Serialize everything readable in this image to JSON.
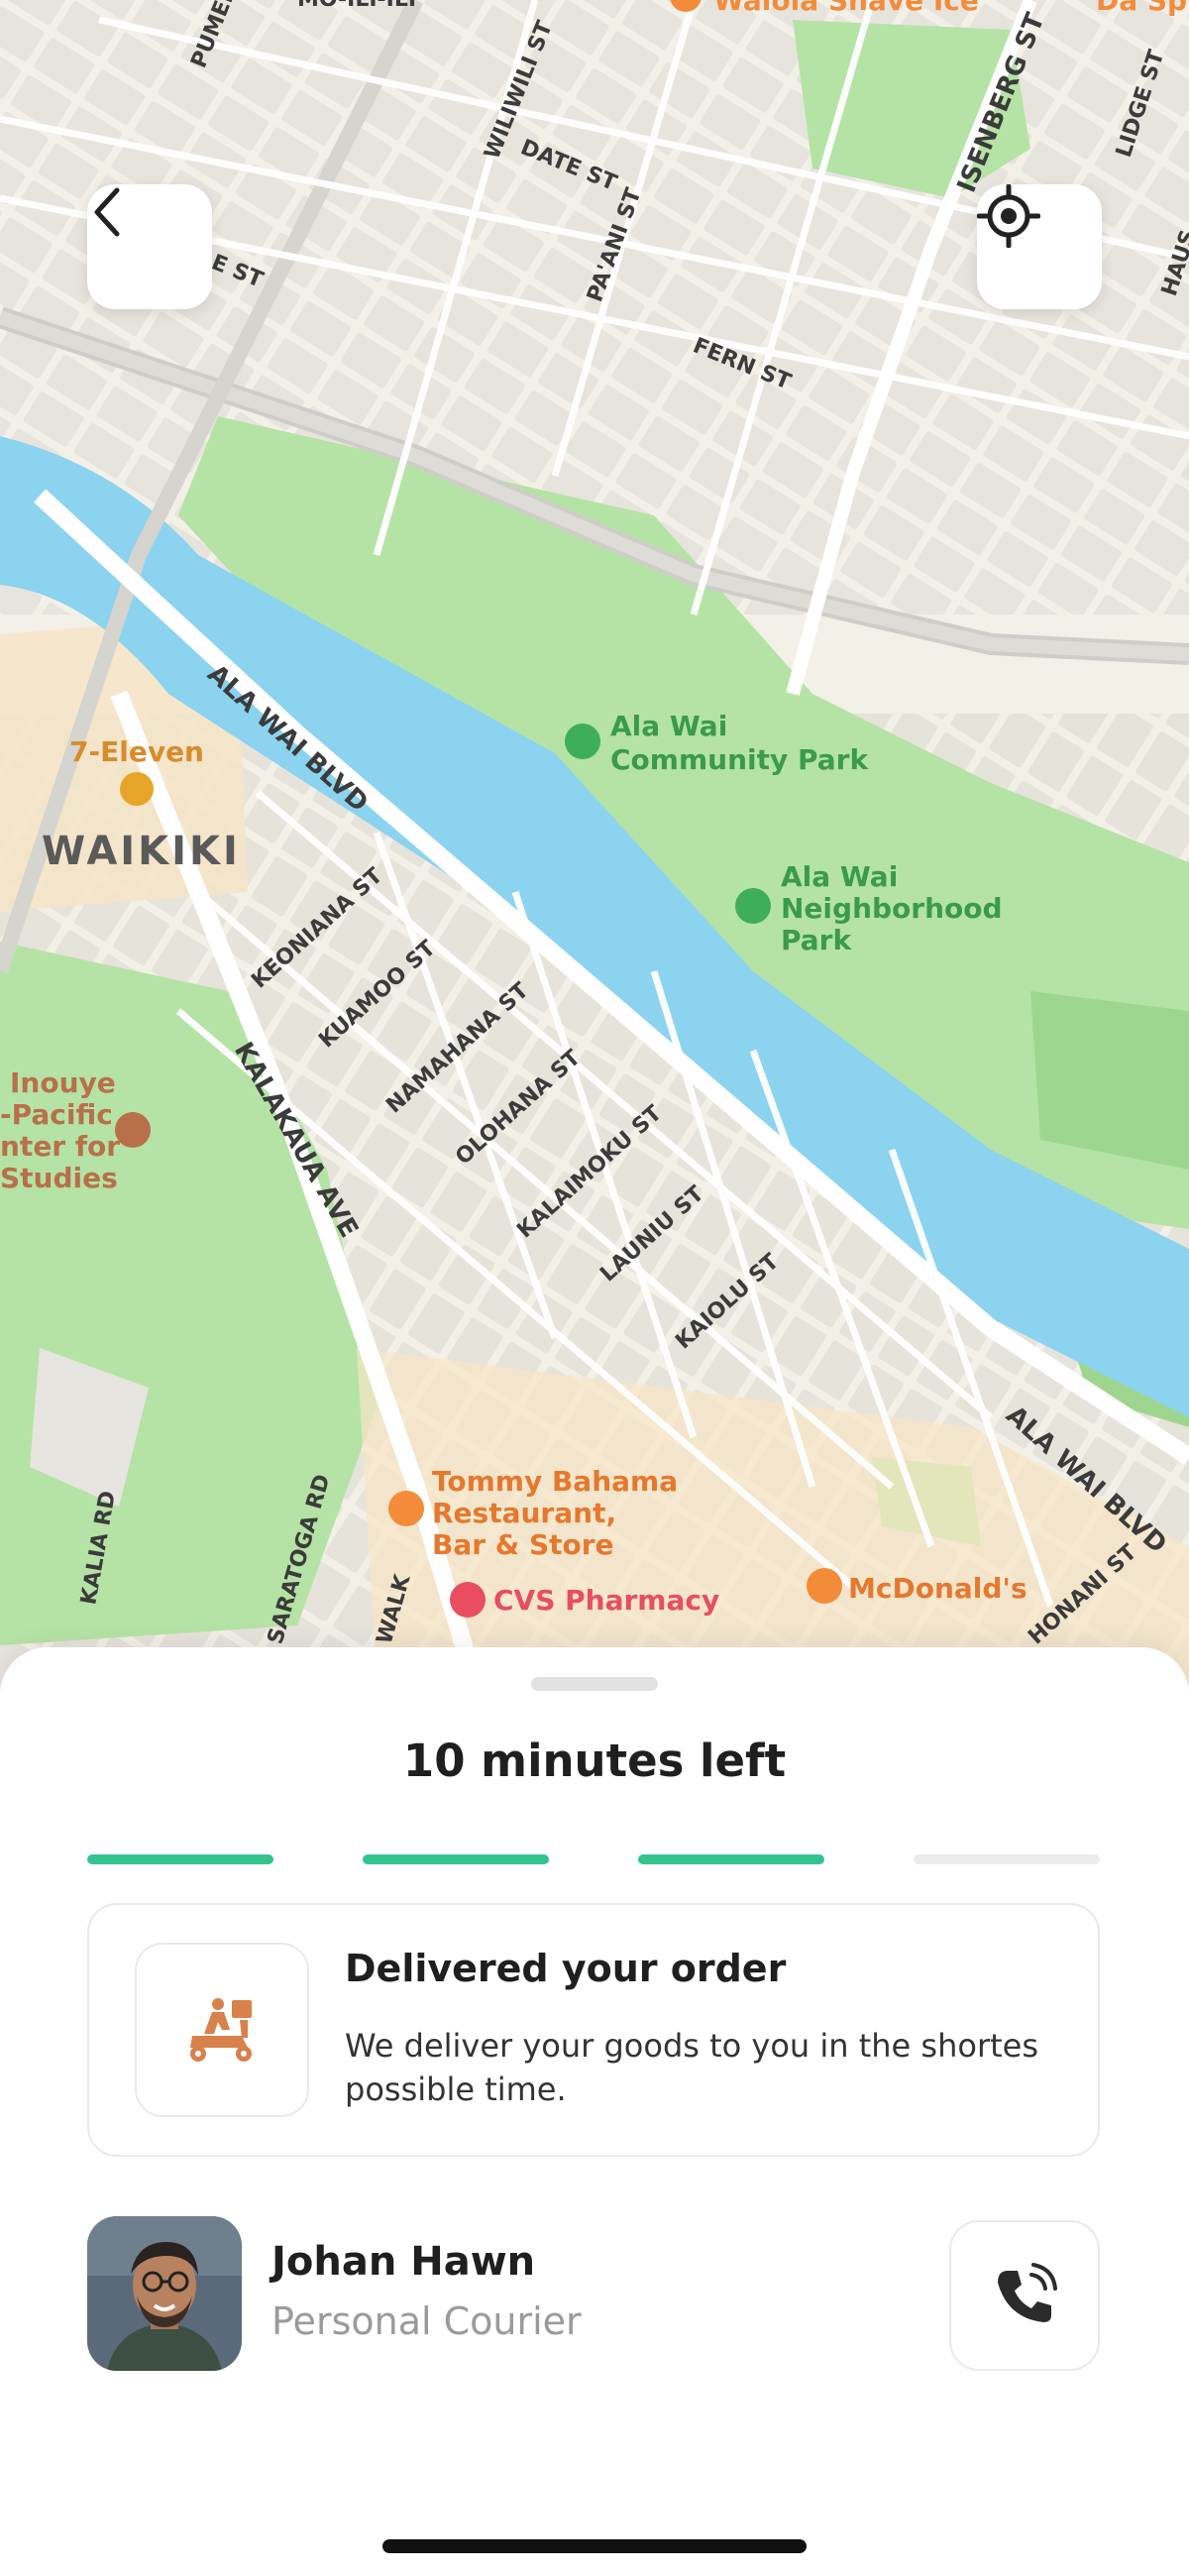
{
  "map": {
    "labels": {
      "top_street_a": "MO-ILI-ILI",
      "top_street_b": "PUMEHANA ST",
      "wiliwili": "WILIWILI ST",
      "date_st": "DATE ST",
      "paani": "PA'ANI ST",
      "isenberg": "ISENBERG ST",
      "date_left": "E ST",
      "fern": "FERN ST",
      "waiola": "Waiola Shave Ice",
      "da_spot": "Da Sp",
      "lidge": "LIDGE ST",
      "haus": "HAUS",
      "ala_wai_blvd_1": "ALA WAI BLVD",
      "ala_wai_blvd_2": "ALA WAI BLVD",
      "seven_eleven": "7-Eleven",
      "waikiki": "WAIKIKI",
      "community_park_1": "Ala Wai",
      "community_park_2": "Community Park",
      "neighborhood_park_1": "Ala Wai",
      "neighborhood_park_2": "Neighborhood",
      "neighborhood_park_3": "Park",
      "keoniana": "KEONIANA ST",
      "kuamoo": "KUAMOO ST",
      "namahana": "NAMAHANA ST",
      "olohana": "OLOHANA ST",
      "kalaimoku": "KALAIMOKU ST",
      "launiu": "LAUNIU ST",
      "kaiolu": "KAIOLU ST",
      "kalakaua": "KALAKAUA AVE",
      "inouye_1": "Inouye",
      "inouye_2": "-Pacific",
      "inouye_3": "nter for",
      "inouye_4": "Studies",
      "kalia": "KALIA RD",
      "saratoga": "SARATOGA RD",
      "walk": "WALK",
      "tommy_1": "Tommy Bahama",
      "tommy_2": "Restaurant,",
      "tommy_3": "Bar & Store",
      "cvs": "CVS Pharmacy",
      "mcdonalds": "McDonald's",
      "honani": "HONANI ST"
    }
  },
  "sheet": {
    "title": "10 minutes left",
    "progress": {
      "completed_steps": 3,
      "total_steps": 4
    },
    "status_card": {
      "title": "Delivered your order",
      "description": "We deliver your goods to you in the shortes possible time."
    },
    "courier": {
      "name": "Johan Hawn",
      "role": "Personal Courier"
    }
  },
  "colors": {
    "accent": "#34c38f",
    "step_inactive": "#ebebeb",
    "water": "#8bd3ef",
    "park": "#a9de9b",
    "icon_orange": "#d8814b"
  },
  "icons": {
    "back": "chevron-left-icon",
    "locate": "crosshair-icon",
    "status": "delivery-scooter-icon",
    "call": "phone-icon"
  }
}
